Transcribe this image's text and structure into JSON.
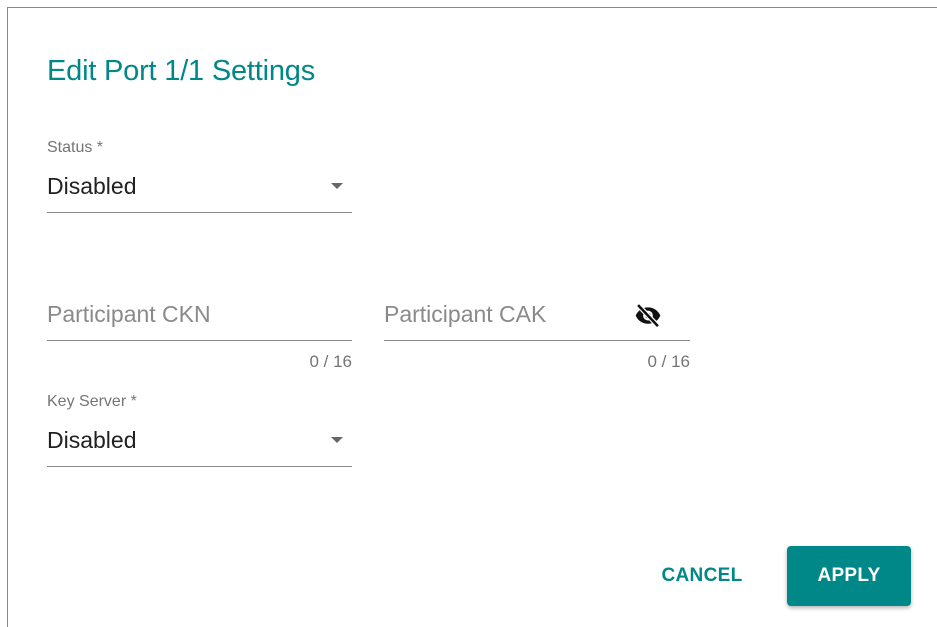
{
  "dialog": {
    "title": "Edit Port 1/1 Settings"
  },
  "status": {
    "label": "Status *",
    "value": "Disabled"
  },
  "participant_ckn": {
    "placeholder": "Participant CKN",
    "counter": "0 / 16"
  },
  "participant_cak": {
    "placeholder": "Participant CAK",
    "counter": "0 / 16",
    "icon": "visibility-off-icon"
  },
  "key_server": {
    "label": "Key Server *",
    "value": "Disabled"
  },
  "actions": {
    "cancel_label": "CANCEL",
    "apply_label": "APPLY"
  },
  "colors": {
    "accent": "#008787",
    "text": "#212121",
    "secondary_text": "#757575"
  }
}
